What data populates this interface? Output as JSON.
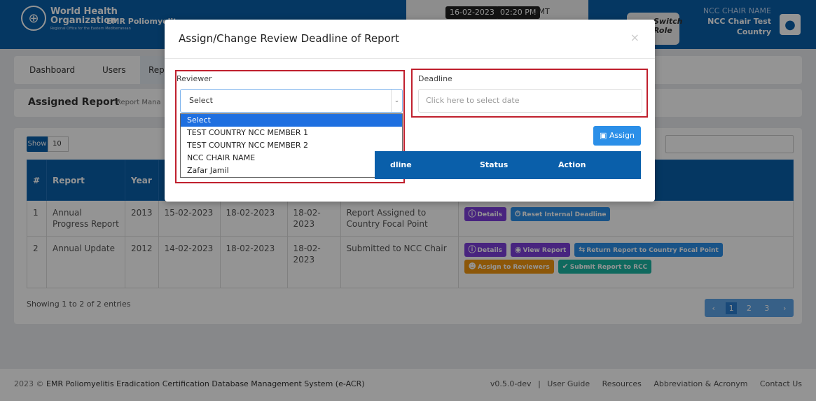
{
  "header": {
    "org_line1": "World Health",
    "org_line2": "Organization",
    "org_sub": "Regional Office for the Eastern Mediterranean",
    "system_short": "EMR Poliomyelit",
    "date": "16-02-2023",
    "time": "02:20 PM",
    "timezone": "GMT",
    "switch_role": "Switch Role",
    "user_role": "NCC CHAIR NAME",
    "user_name": "NCC Chair Test",
    "user_country": "Country"
  },
  "nav": {
    "items": [
      "Dashboard",
      "Users",
      "Rep"
    ]
  },
  "subheader": {
    "title": "Assigned Report",
    "breadcrumb": "Report Mana"
  },
  "table": {
    "show_label": "Show",
    "show_value": "10",
    "headers": [
      "#",
      "Report",
      "Year",
      "",
      "",
      "",
      "",
      "",
      ""
    ],
    "rows": [
      {
        "num": "1",
        "report": "Annual Progress Report",
        "year": "2013",
        "d1": "15-02-2023",
        "d2": "18-02-2023",
        "d3": "18-02-2023",
        "status": "Report Assigned to Country Focal Point",
        "actions": [
          "Details",
          "Reset Internal Deadline"
        ]
      },
      {
        "num": "2",
        "report": "Annual Update",
        "year": "2012",
        "d1": "14-02-2023",
        "d2": "18-02-2023",
        "d3": "18-02-2023",
        "status": "Submitted to NCC Chair",
        "actions": [
          "Details",
          "View Report",
          "Return Report to Country Focal Point",
          "Assign to Reviewers",
          "Submit Report to RCC"
        ]
      }
    ],
    "entries_info": "Showing 1 to 2 of 2 entries",
    "pages": [
      "1",
      "2",
      "3"
    ]
  },
  "footer": {
    "year": "2023 ©",
    "system_name": "EMR Poliomyelitis Eradication Certification Database Management System (e-ACR)",
    "version": "v0.5.0-dev",
    "links": [
      "User Guide",
      "Resources",
      "Abbreviation & Acronym",
      "Contact Us"
    ]
  },
  "modal": {
    "title": "Assign/Change Review Deadline of Report",
    "close": "×",
    "reviewer_label": "Reviewer",
    "reviewer_selected": "Select",
    "reviewer_options": [
      "Select",
      "TEST COUNTRY NCC MEMBER 1",
      "TEST COUNTRY NCC MEMBER 2",
      "NCC CHAIR NAME",
      "Zafar Jamil"
    ],
    "deadline_label": "Deadline",
    "deadline_placeholder": "Click here to select date",
    "assign_button": "Assign",
    "table_headers": [
      "dline",
      "Status",
      "Action"
    ]
  },
  "colors": {
    "brand": "#0a5faa",
    "highlight": "#c0202e"
  }
}
